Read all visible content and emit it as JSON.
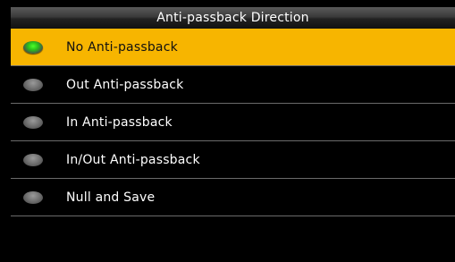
{
  "header": {
    "title": "Anti-passback Direction"
  },
  "options": [
    {
      "label": "No Anti-passback",
      "selected": true
    },
    {
      "label": "Out Anti-passback",
      "selected": false
    },
    {
      "label": "In Anti-passback",
      "selected": false
    },
    {
      "label": "In/Out Anti-passback",
      "selected": false
    },
    {
      "label": "Null and Save",
      "selected": false
    }
  ],
  "colors": {
    "highlight": "#f7b500",
    "background": "#000000",
    "radio_on": "#2bc11a",
    "radio_off": "#6a6a6a"
  },
  "icons": {
    "radio_on": "radio-selected-icon",
    "radio_off": "radio-unselected-icon"
  }
}
